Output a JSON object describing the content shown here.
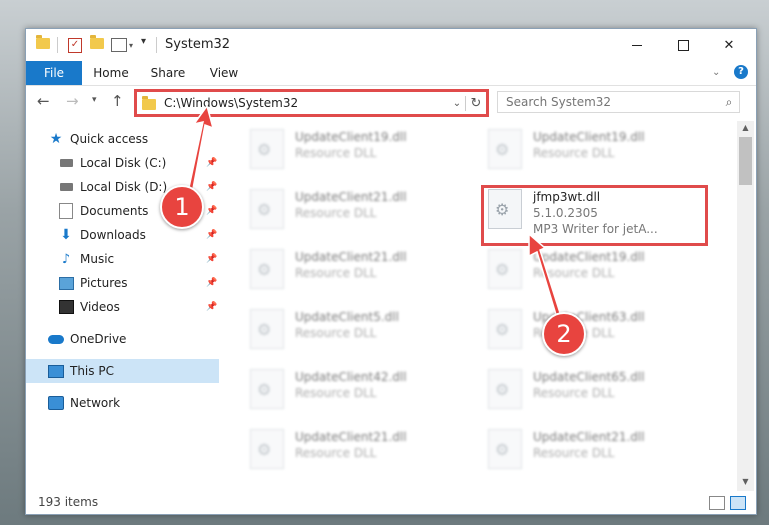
{
  "window": {
    "title": "System32",
    "controls": {
      "minimize": "minimize",
      "maximize": "maximize",
      "close": "close"
    }
  },
  "ribbon": {
    "tabs": [
      "File",
      "Home",
      "Share",
      "View"
    ]
  },
  "address": {
    "path": "C:\\Windows\\System32",
    "search_placeholder": "Search System32"
  },
  "nav": {
    "items": [
      {
        "label": "Quick access",
        "icon": "star-icon"
      },
      {
        "label": "Local Disk (C:)",
        "icon": "drive-icon",
        "pinned": true
      },
      {
        "label": "Local Disk (D:)",
        "icon": "drive-icon",
        "pinned": true
      },
      {
        "label": "Documents",
        "icon": "documents-icon",
        "pinned": true
      },
      {
        "label": "Downloads",
        "icon": "download-icon",
        "pinned": true
      },
      {
        "label": "Music",
        "icon": "music-icon",
        "pinned": true
      },
      {
        "label": "Pictures",
        "icon": "pictures-icon",
        "pinned": true
      },
      {
        "label": "Videos",
        "icon": "videos-icon",
        "pinned": true
      },
      {
        "label": "OneDrive",
        "icon": "cloud-icon"
      },
      {
        "label": "This PC",
        "icon": "computer-icon",
        "selected": true
      },
      {
        "label": "Network",
        "icon": "network-icon"
      }
    ]
  },
  "files": {
    "left": [
      {
        "name": "UpdateClient19.dll",
        "desc": "Resource DLL"
      },
      {
        "name": "UpdateClient21.dll",
        "desc": "Resource DLL"
      },
      {
        "name": "UpdateClient21.dll",
        "desc": "Resource DLL"
      },
      {
        "name": "UpdateClient5.dll",
        "desc": "Resource DLL"
      },
      {
        "name": "UpdateClient42.dll",
        "desc": "Resource DLL"
      },
      {
        "name": "UpdateClient21.dll",
        "desc": "Resource DLL"
      }
    ],
    "right": [
      {
        "name": "UpdateClient19.dll",
        "desc": "Resource DLL"
      },
      {
        "name": "jfmp3wt.dll",
        "version": "5.1.0.2305",
        "desc": "MP3 Writer for jetA..."
      },
      {
        "name": "UpdateClient19.dll",
        "desc": "Resource DLL"
      },
      {
        "name": "UpdateClient63.dll",
        "desc": "Resource DLL"
      },
      {
        "name": "UpdateClient65.dll",
        "desc": "Resource DLL"
      },
      {
        "name": "UpdateClient21.dll",
        "desc": "Resource DLL"
      }
    ]
  },
  "status": {
    "item_count": "193 items"
  },
  "annotations": {
    "step1": "1",
    "step2": "2"
  },
  "colors": {
    "accent": "#1979ca",
    "annotation": "#e04b4b"
  }
}
